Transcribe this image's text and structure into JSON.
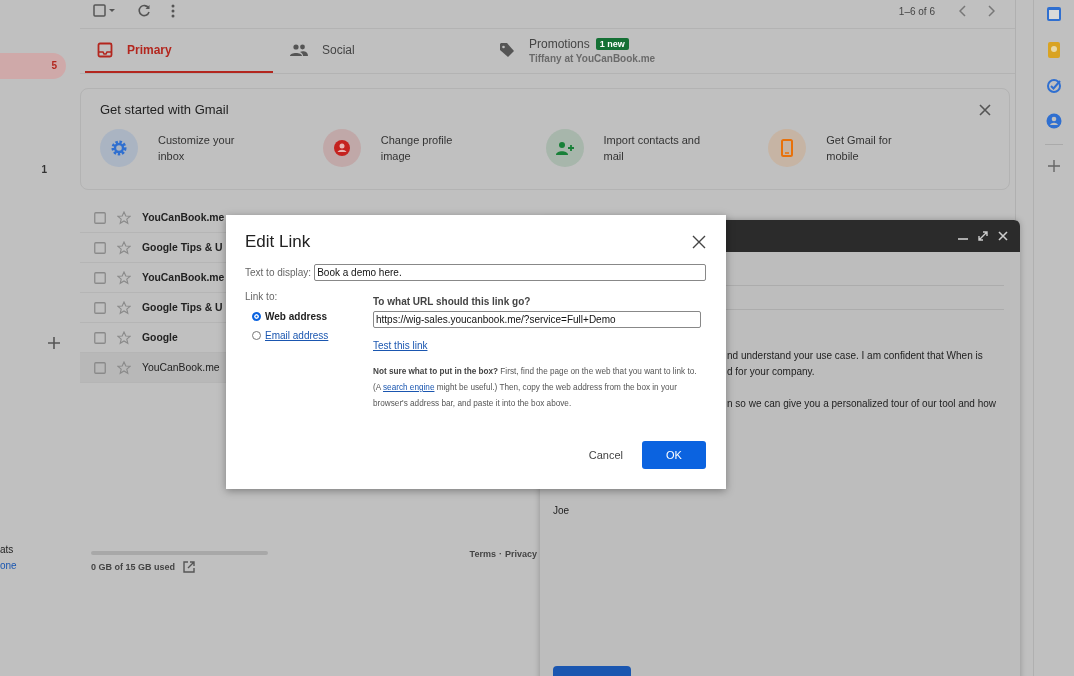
{
  "toolbar": {
    "page_range": "1–6 of 6"
  },
  "sidebar": {
    "counts": [
      {
        "text": "5",
        "selected": true
      },
      {
        "text": "1",
        "selected": false
      }
    ],
    "bottom_lines": [
      "ats",
      "one"
    ]
  },
  "tabs": [
    {
      "label": "Primary",
      "selected": true
    },
    {
      "label": "Social",
      "selected": false
    },
    {
      "label": "Promotions",
      "selected": false,
      "badge": "1 new",
      "subtitle": "Tiffany at YouCanBook.me"
    }
  ],
  "get_started": {
    "title": "Get started with Gmail",
    "items": [
      {
        "kind": "settings",
        "label": "Customize your inbox",
        "color": "#2f6fd0"
      },
      {
        "kind": "profile",
        "label": "Change profile image",
        "color": "#c5221f"
      },
      {
        "kind": "contacts",
        "label": "Import contacts and mail",
        "color": "#188038"
      },
      {
        "kind": "phone",
        "label": "Get Gmail for mobile",
        "color": "#e8710a"
      }
    ]
  },
  "rows": [
    {
      "sender": "YouCanBook.me",
      "unread": true
    },
    {
      "sender": "Google Tips & U",
      "unread": true
    },
    {
      "sender": "YouCanBook.me",
      "unread": true
    },
    {
      "sender": "Google Tips & U",
      "unread": true
    },
    {
      "sender": "Google",
      "unread": true
    },
    {
      "sender": "YouCanBook.me",
      "unread": false
    }
  ],
  "storage": {
    "text": "0 GB of 15 GB used"
  },
  "footer": {
    "links": [
      "Terms",
      "Privacy"
    ],
    "separator": "·"
  },
  "compose": {
    "paragraphs": [
      [
        "nd understand your use case. I am confident that When is",
        "d for your company."
      ],
      [
        "n so we can give you a personalized tour of our tool and how"
      ]
    ],
    "signature": "Joe"
  },
  "dialog": {
    "title": "Edit Link",
    "display_label": "Text to display:",
    "display_value": "Book a demo here.",
    "link_to_label": "Link to:",
    "options": [
      {
        "label": "Web address",
        "selected": true
      },
      {
        "label": "Email address",
        "selected": false
      }
    ],
    "url_heading": "To what URL should this link go?",
    "url_value": "https://wig-sales.youcanbook.me/?service=Full+Demo",
    "test_link": "Test this link",
    "help_bold": "Not sure what to put in the box?",
    "help_before": "First, find the page on the web that you want to link to. (A",
    "help_link": "search engine",
    "help_after": "might be useful.) Then, copy the web address from the box in your browser's address bar, and paste it into the box above.",
    "buttons": [
      {
        "label": "Cancel",
        "kind": "text"
      },
      {
        "label": "OK",
        "kind": "primary"
      }
    ]
  }
}
